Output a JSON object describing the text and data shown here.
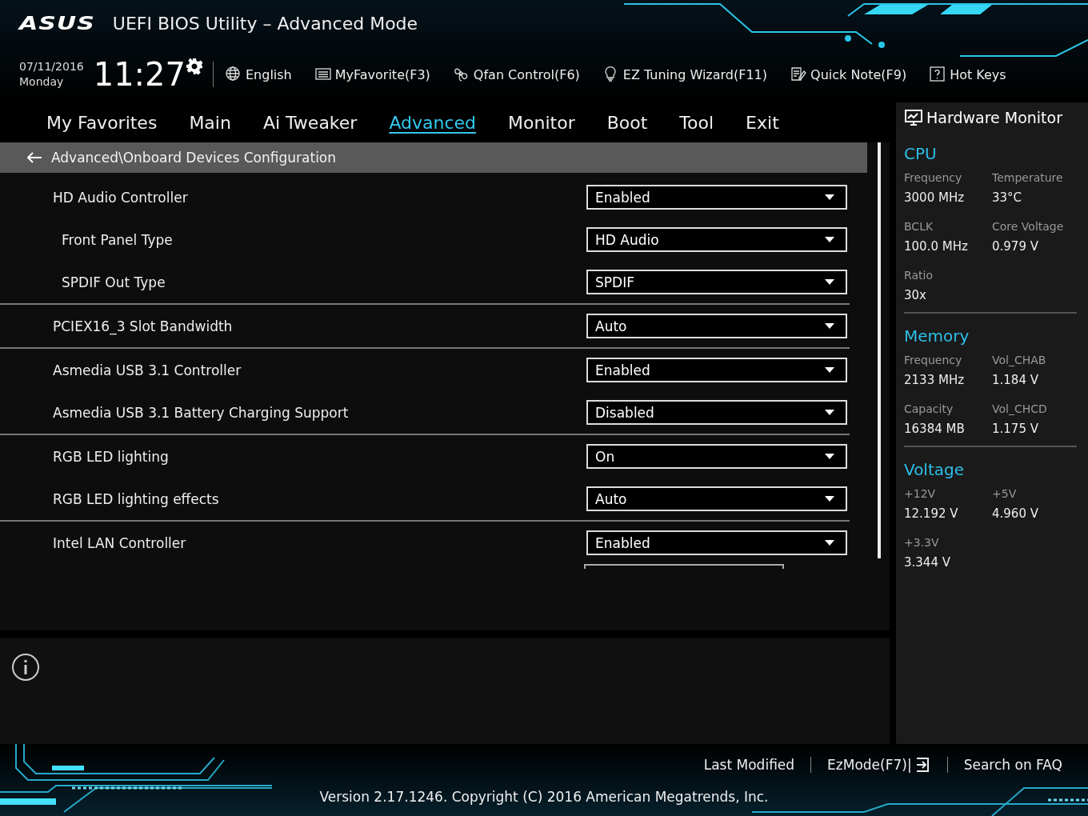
{
  "window": {
    "logo": "ASUS",
    "title": "UEFI BIOS Utility – Advanced Mode"
  },
  "clock": {
    "date": "07/11/2016",
    "day": "Monday",
    "time": "11:27"
  },
  "toolbar": [
    {
      "label": "English"
    },
    {
      "label": "MyFavorite(F3)"
    },
    {
      "label": "Qfan Control(F6)"
    },
    {
      "label": "EZ Tuning Wizard(F11)"
    },
    {
      "label": "Quick Note(F9)"
    },
    {
      "label": "Hot Keys"
    }
  ],
  "tabs": [
    {
      "label": "My Favorites",
      "selected": false
    },
    {
      "label": "Main",
      "selected": false
    },
    {
      "label": "Ai Tweaker",
      "selected": false
    },
    {
      "label": "Advanced",
      "selected": true
    },
    {
      "label": "Monitor",
      "selected": false
    },
    {
      "label": "Boot",
      "selected": false
    },
    {
      "label": "Tool",
      "selected": false
    },
    {
      "label": "Exit",
      "selected": false
    }
  ],
  "breadcrumb": "Advanced\\Onboard Devices Configuration",
  "groups": [
    [
      {
        "label": "HD Audio Controller",
        "value": "Enabled",
        "children": [
          {
            "label": "Front Panel Type",
            "value": "HD Audio"
          },
          {
            "label": "SPDIF Out Type",
            "value": "SPDIF"
          }
        ]
      }
    ],
    [
      {
        "label": "PCIEX16_3 Slot Bandwidth",
        "value": "Auto"
      }
    ],
    [
      {
        "label": "Asmedia USB 3.1 Controller",
        "value": "Enabled"
      },
      {
        "label": "Asmedia USB 3.1 Battery Charging Support",
        "value": "Disabled"
      }
    ],
    [
      {
        "label": "RGB LED lighting",
        "value": "On"
      },
      {
        "label": "RGB LED lighting effects",
        "value": "Auto"
      }
    ],
    [
      {
        "label": "Intel LAN Controller",
        "value": "Enabled"
      }
    ]
  ],
  "hardware_monitor": {
    "title": "Hardware Monitor",
    "sections": [
      {
        "title": "CPU",
        "readings": [
          {
            "label": "Frequency",
            "value": "3000 MHz"
          },
          {
            "label": "Temperature",
            "value": "33°C"
          },
          {
            "label": "BCLK",
            "value": "100.0 MHz"
          },
          {
            "label": "Core Voltage",
            "value": "0.979 V"
          },
          {
            "label": "Ratio",
            "value": "30x"
          }
        ]
      },
      {
        "title": "Memory",
        "readings": [
          {
            "label": "Frequency",
            "value": "2133 MHz"
          },
          {
            "label": "Vol_CHAB",
            "value": "1.184 V"
          },
          {
            "label": "Capacity",
            "value": "16384 MB"
          },
          {
            "label": "Vol_CHCD",
            "value": "1.175 V"
          }
        ]
      },
      {
        "title": "Voltage",
        "readings": [
          {
            "label": "+12V",
            "value": "12.192 V"
          },
          {
            "label": "+5V",
            "value": "4.960 V"
          },
          {
            "label": "+3.3V",
            "value": "3.344 V"
          }
        ]
      }
    ]
  },
  "footer": {
    "links": [
      "Last Modified",
      "EzMode(F7)|",
      "Search on FAQ"
    ],
    "copyright": "Version 2.17.1246. Copyright (C) 2016 American Megatrends, Inc."
  }
}
